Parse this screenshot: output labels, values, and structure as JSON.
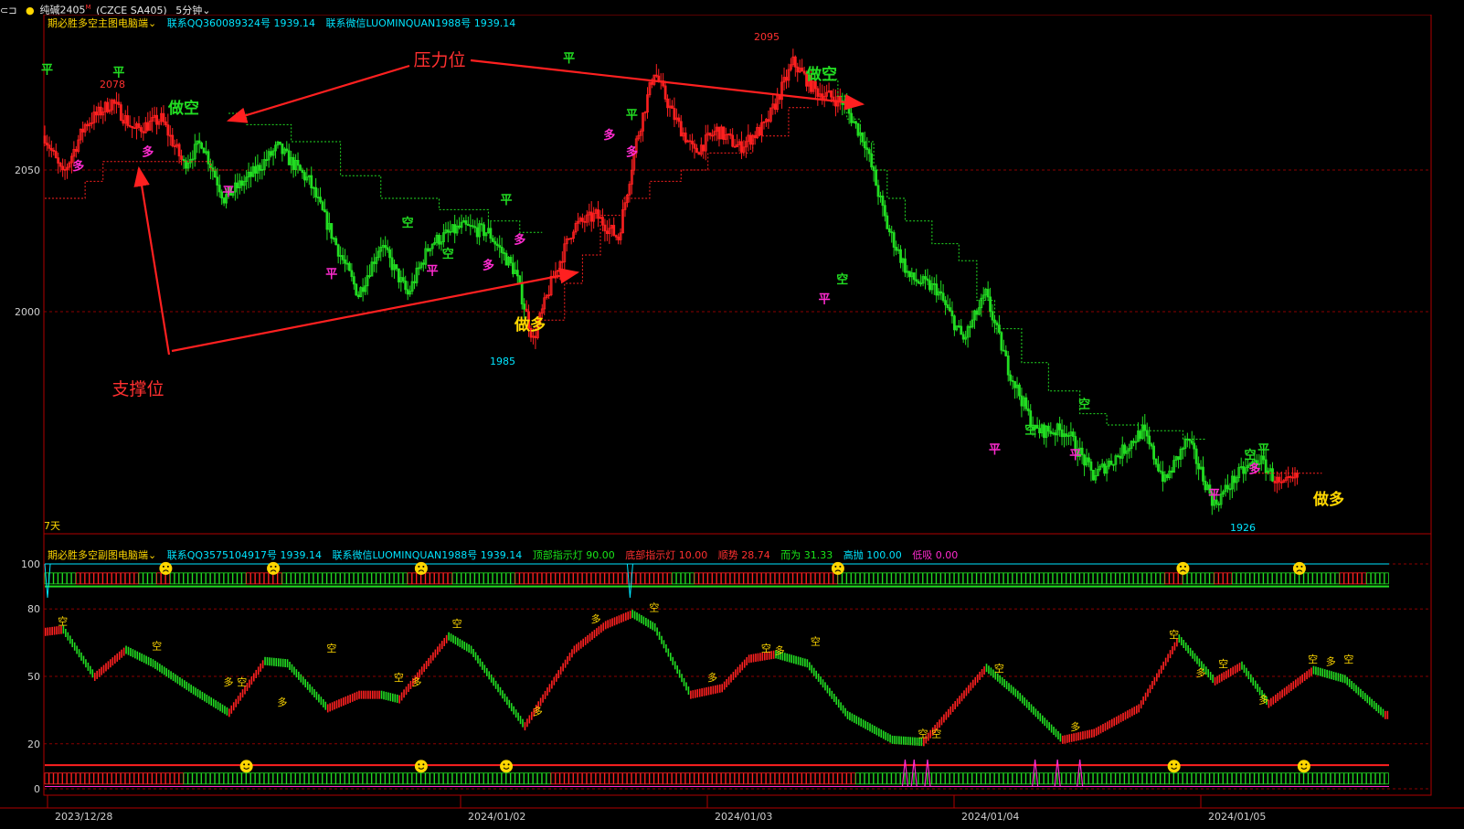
{
  "topbar": {
    "menu_icon": "window-menu-icon",
    "dot_color": "#ffd700",
    "symbol": "纯碱2405",
    "symbol_sup": "M",
    "code": "(CZCE SA405)",
    "period": "5分钟"
  },
  "main_panel": {
    "title": "期必胜多空主图电脑端",
    "contact_qq": "联系QQ360089324号 1939.14",
    "contact_wx": "联系微信LUOMINQUAN1988号 1939.14",
    "corner_label": "7天",
    "annotations": {
      "pressure": "压力位",
      "support": "支撑位",
      "do_short_1": "做空",
      "do_short_2": "做空",
      "do_long_1": "做多",
      "do_long_2": "做多"
    },
    "price_labels": {
      "high1": "2078",
      "high2": "2095",
      "low1": "1985",
      "low2": "1926"
    }
  },
  "sub_panel": {
    "title": "期必胜多空副图电脑端",
    "contact_qq": "联系QQ3575104917号 1939.14",
    "contact_wx": "联系微信LUOMINQUAN1988号 1939.14",
    "top_light": "顶部指示灯 90.00",
    "bottom_light": "底部指示灯 10.00",
    "trend": "顺势 28.74",
    "wei": "而为 31.33",
    "high_sell": "高抛 100.00",
    "low_buy": "低吸 0.00"
  },
  "x_axis": [
    "2023/12/28",
    "2024/01/02",
    "2024/01/03",
    "2024/01/04",
    "2024/01/05"
  ],
  "colors": {
    "up": "#ff2020",
    "down": "#22dd22",
    "grid": "#8b0000",
    "resist": "#22dd22",
    "support": "#ff2020",
    "arrow": "#ff2020",
    "axis_text": "#cfcfcf"
  },
  "chart_data": [
    {
      "type": "candlestick",
      "title": "期必胜多空主图电脑端",
      "y_ticks": [
        2050,
        2000
      ],
      "ylim": [
        1920,
        2110
      ],
      "path_points": [
        {
          "i": 0,
          "p": 2062
        },
        {
          "i": 8,
          "p": 2048
        },
        {
          "i": 18,
          "p": 2066
        },
        {
          "i": 30,
          "p": 2074
        },
        {
          "i": 40,
          "p": 2064
        },
        {
          "i": 52,
          "p": 2068
        },
        {
          "i": 62,
          "p": 2052
        },
        {
          "i": 70,
          "p": 2060
        },
        {
          "i": 80,
          "p": 2040
        },
        {
          "i": 92,
          "p": 2048
        },
        {
          "i": 104,
          "p": 2058
        },
        {
          "i": 118,
          "p": 2046
        },
        {
          "i": 132,
          "p": 2020
        },
        {
          "i": 140,
          "p": 2006
        },
        {
          "i": 150,
          "p": 2024
        },
        {
          "i": 162,
          "p": 2006
        },
        {
          "i": 172,
          "p": 2024
        },
        {
          "i": 186,
          "p": 2030
        },
        {
          "i": 198,
          "p": 2028
        },
        {
          "i": 210,
          "p": 2014
        },
        {
          "i": 218,
          "p": 1990
        },
        {
          "i": 226,
          "p": 2010
        },
        {
          "i": 236,
          "p": 2030
        },
        {
          "i": 246,
          "p": 2034
        },
        {
          "i": 256,
          "p": 2026
        },
        {
          "i": 264,
          "p": 2060
        },
        {
          "i": 272,
          "p": 2085
        },
        {
          "i": 280,
          "p": 2070
        },
        {
          "i": 290,
          "p": 2056
        },
        {
          "i": 300,
          "p": 2064
        },
        {
          "i": 310,
          "p": 2058
        },
        {
          "i": 322,
          "p": 2066
        },
        {
          "i": 334,
          "p": 2088
        },
        {
          "i": 344,
          "p": 2078
        },
        {
          "i": 356,
          "p": 2074
        },
        {
          "i": 366,
          "p": 2060
        },
        {
          "i": 376,
          "p": 2030
        },
        {
          "i": 386,
          "p": 2012
        },
        {
          "i": 398,
          "p": 2008
        },
        {
          "i": 410,
          "p": 1990
        },
        {
          "i": 420,
          "p": 2006
        },
        {
          "i": 430,
          "p": 1980
        },
        {
          "i": 442,
          "p": 1958
        },
        {
          "i": 456,
          "p": 1958
        },
        {
          "i": 468,
          "p": 1942
        },
        {
          "i": 480,
          "p": 1950
        },
        {
          "i": 490,
          "p": 1958
        },
        {
          "i": 500,
          "p": 1940
        },
        {
          "i": 510,
          "p": 1955
        },
        {
          "i": 522,
          "p": 1932
        },
        {
          "i": 532,
          "p": 1942
        },
        {
          "i": 542,
          "p": 1948
        },
        {
          "i": 552,
          "p": 1938
        },
        {
          "i": 560,
          "p": 1942
        }
      ],
      "resistance_steps": [
        {
          "i": 82,
          "p": 2070
        },
        {
          "i": 90,
          "p": 2066
        },
        {
          "i": 110,
          "p": 2060
        },
        {
          "i": 132,
          "p": 2048
        },
        {
          "i": 150,
          "p": 2040
        },
        {
          "i": 176,
          "p": 2036
        },
        {
          "i": 198,
          "p": 2032
        },
        {
          "i": 212,
          "p": 2028
        },
        {
          "i": 348,
          "p": 2082
        },
        {
          "i": 354,
          "p": 2076
        },
        {
          "i": 358,
          "p": 2068
        },
        {
          "i": 364,
          "p": 2060
        },
        {
          "i": 370,
          "p": 2050
        },
        {
          "i": 376,
          "p": 2040
        },
        {
          "i": 384,
          "p": 2032
        },
        {
          "i": 396,
          "p": 2024
        },
        {
          "i": 408,
          "p": 2018
        },
        {
          "i": 416,
          "p": 2004
        },
        {
          "i": 424,
          "p": 1994
        },
        {
          "i": 436,
          "p": 1982
        },
        {
          "i": 448,
          "p": 1972
        },
        {
          "i": 462,
          "p": 1964
        },
        {
          "i": 474,
          "p": 1960
        },
        {
          "i": 490,
          "p": 1958
        },
        {
          "i": 508,
          "p": 1955
        }
      ],
      "support_steps": [
        {
          "i": 0,
          "p": 2040
        },
        {
          "i": 18,
          "p": 2046
        },
        {
          "i": 26,
          "p": 2053
        },
        {
          "i": 74,
          "p": 2050
        },
        {
          "i": 218,
          "p": 1997
        },
        {
          "i": 232,
          "p": 2010
        },
        {
          "i": 240,
          "p": 2020
        },
        {
          "i": 248,
          "p": 2034
        },
        {
          "i": 258,
          "p": 2040
        },
        {
          "i": 270,
          "p": 2046
        },
        {
          "i": 284,
          "p": 2050
        },
        {
          "i": 296,
          "p": 2056
        },
        {
          "i": 316,
          "p": 2062
        },
        {
          "i": 332,
          "p": 2072
        },
        {
          "i": 540,
          "p": 1943
        },
        {
          "i": 560,
          "p": 1943
        }
      ],
      "signals": [
        {
          "i": 1,
          "p": 2084,
          "t": "平",
          "c": "#22dd22"
        },
        {
          "i": 33,
          "p": 2083,
          "t": "平",
          "c": "#22dd22"
        },
        {
          "i": 15,
          "p": 2050,
          "t": "多",
          "c": "#ff2bd0"
        },
        {
          "i": 46,
          "p": 2055,
          "t": "多",
          "c": "#ff2bd0"
        },
        {
          "i": 82,
          "p": 2041,
          "t": "平",
          "c": "#ff2bd0"
        },
        {
          "i": 128,
          "p": 2012,
          "t": "平",
          "c": "#ff2bd0"
        },
        {
          "i": 162,
          "p": 2030,
          "t": "空",
          "c": "#22dd22"
        },
        {
          "i": 180,
          "p": 2019,
          "t": "空",
          "c": "#22dd22"
        },
        {
          "i": 173,
          "p": 2013,
          "t": "平",
          "c": "#ff2bd0"
        },
        {
          "i": 198,
          "p": 2015,
          "t": "多",
          "c": "#ff2bd0"
        },
        {
          "i": 206,
          "p": 2038,
          "t": "平",
          "c": "#22dd22"
        },
        {
          "i": 212,
          "p": 2024,
          "t": "多",
          "c": "#ff2bd0"
        },
        {
          "i": 234,
          "p": 2088,
          "t": "平",
          "c": "#22dd22"
        },
        {
          "i": 252,
          "p": 2061,
          "t": "多",
          "c": "#ff2bd0"
        },
        {
          "i": 262,
          "p": 2068,
          "t": "平",
          "c": "#22dd22"
        },
        {
          "i": 262,
          "p": 2055,
          "t": "多",
          "c": "#ff2bd0"
        },
        {
          "i": 356,
          "p": 2010,
          "t": "空",
          "c": "#22dd22"
        },
        {
          "i": 348,
          "p": 2003,
          "t": "平",
          "c": "#ff2bd0"
        },
        {
          "i": 424,
          "p": 1950,
          "t": "平",
          "c": "#ff2bd0"
        },
        {
          "i": 440,
          "p": 1957,
          "t": "空",
          "c": "#22dd22"
        },
        {
          "i": 460,
          "p": 1948,
          "t": "平",
          "c": "#ff2bd0"
        },
        {
          "i": 464,
          "p": 1966,
          "t": "空",
          "c": "#22dd22"
        },
        {
          "i": 522,
          "p": 1934,
          "t": "平",
          "c": "#ff2bd0"
        },
        {
          "i": 538,
          "p": 1948,
          "t": "空",
          "c": "#22dd22"
        },
        {
          "i": 544,
          "p": 1950,
          "t": "平",
          "c": "#22dd22"
        },
        {
          "i": 540,
          "p": 1943,
          "t": "多",
          "c": "#ff2bd0"
        }
      ]
    },
    {
      "type": "bar",
      "title": "期必胜多空副图电脑端",
      "y_ticks": [
        100,
        80,
        50,
        20,
        0
      ],
      "ylim": [
        0,
        100
      ],
      "curve_points": [
        {
          "i": 0,
          "v": 70
        },
        {
          "i": 8,
          "v": 71
        },
        {
          "i": 22,
          "v": 50
        },
        {
          "i": 36,
          "v": 62
        },
        {
          "i": 48,
          "v": 56
        },
        {
          "i": 66,
          "v": 44
        },
        {
          "i": 82,
          "v": 34
        },
        {
          "i": 98,
          "v": 57
        },
        {
          "i": 108,
          "v": 56
        },
        {
          "i": 126,
          "v": 36
        },
        {
          "i": 140,
          "v": 42
        },
        {
          "i": 150,
          "v": 42
        },
        {
          "i": 158,
          "v": 40
        },
        {
          "i": 180,
          "v": 68
        },
        {
          "i": 190,
          "v": 62
        },
        {
          "i": 214,
          "v": 28
        },
        {
          "i": 236,
          "v": 62
        },
        {
          "i": 250,
          "v": 73
        },
        {
          "i": 262,
          "v": 78
        },
        {
          "i": 272,
          "v": 72
        },
        {
          "i": 288,
          "v": 42
        },
        {
          "i": 302,
          "v": 45
        },
        {
          "i": 314,
          "v": 58
        },
        {
          "i": 326,
          "v": 60
        },
        {
          "i": 340,
          "v": 56
        },
        {
          "i": 358,
          "v": 33
        },
        {
          "i": 378,
          "v": 22
        },
        {
          "i": 392,
          "v": 21
        },
        {
          "i": 404,
          "v": 35
        },
        {
          "i": 420,
          "v": 54
        },
        {
          "i": 434,
          "v": 42
        },
        {
          "i": 454,
          "v": 22
        },
        {
          "i": 468,
          "v": 25
        },
        {
          "i": 488,
          "v": 36
        },
        {
          "i": 506,
          "v": 67
        },
        {
          "i": 522,
          "v": 48
        },
        {
          "i": 534,
          "v": 55
        },
        {
          "i": 546,
          "v": 38
        },
        {
          "i": 566,
          "v": 53
        },
        {
          "i": 580,
          "v": 49
        },
        {
          "i": 598,
          "v": 33
        }
      ],
      "signals": [
        {
          "i": 8,
          "v": 73,
          "t": "空",
          "c": "#ffd700"
        },
        {
          "i": 50,
          "v": 62,
          "t": "空",
          "c": "#ffd700"
        },
        {
          "i": 88,
          "v": 46,
          "t": "空",
          "c": "#ffd700"
        },
        {
          "i": 82,
          "v": 46,
          "t": "多",
          "c": "#ffd700"
        },
        {
          "i": 106,
          "v": 37,
          "t": "多",
          "c": "#ffd700"
        },
        {
          "i": 128,
          "v": 61,
          "t": "空",
          "c": "#ffd700"
        },
        {
          "i": 158,
          "v": 48,
          "t": "空",
          "c": "#ffd700"
        },
        {
          "i": 166,
          "v": 46,
          "t": "多",
          "c": "#ffd700"
        },
        {
          "i": 184,
          "v": 72,
          "t": "空",
          "c": "#ffd700"
        },
        {
          "i": 220,
          "v": 33,
          "t": "多",
          "c": "#ffd700"
        },
        {
          "i": 246,
          "v": 74,
          "t": "多",
          "c": "#ffd700"
        },
        {
          "i": 272,
          "v": 79,
          "t": "空",
          "c": "#ffd700"
        },
        {
          "i": 298,
          "v": 48,
          "t": "多",
          "c": "#ffd700"
        },
        {
          "i": 322,
          "v": 61,
          "t": "空",
          "c": "#ffd700"
        },
        {
          "i": 328,
          "v": 60,
          "t": "多",
          "c": "#ffd700"
        },
        {
          "i": 344,
          "v": 64,
          "t": "空",
          "c": "#ffd700"
        },
        {
          "i": 392,
          "v": 23,
          "t": "空",
          "c": "#ffd700"
        },
        {
          "i": 398,
          "v": 23,
          "t": "空",
          "c": "#ffd700"
        },
        {
          "i": 426,
          "v": 52,
          "t": "空",
          "c": "#ffd700"
        },
        {
          "i": 460,
          "v": 26,
          "t": "多",
          "c": "#ffd700"
        },
        {
          "i": 504,
          "v": 67,
          "t": "空",
          "c": "#ffd700"
        },
        {
          "i": 516,
          "v": 50,
          "t": "多",
          "c": "#ffd700"
        },
        {
          "i": 526,
          "v": 54,
          "t": "空",
          "c": "#ffd700"
        },
        {
          "i": 544,
          "v": 38,
          "t": "多",
          "c": "#ffd700"
        },
        {
          "i": 566,
          "v": 56,
          "t": "空",
          "c": "#ffd700"
        },
        {
          "i": 574,
          "v": 55,
          "t": "多",
          "c": "#ffd700"
        },
        {
          "i": 582,
          "v": 56,
          "t": "空",
          "c": "#ffd700"
        }
      ],
      "top_band_segments": [
        {
          "from": 0,
          "to": 14,
          "c": "#22dd22"
        },
        {
          "from": 14,
          "to": 42,
          "c": "#ff2020"
        },
        {
          "from": 42,
          "to": 50,
          "c": "#22dd22"
        },
        {
          "from": 50,
          "to": 56,
          "c": "#ff2020"
        },
        {
          "from": 56,
          "to": 90,
          "c": "#22dd22"
        },
        {
          "from": 90,
          "to": 106,
          "c": "#ff2020"
        },
        {
          "from": 106,
          "to": 162,
          "c": "#22dd22"
        },
        {
          "from": 162,
          "to": 182,
          "c": "#ff2020"
        },
        {
          "from": 182,
          "to": 210,
          "c": "#22dd22"
        },
        {
          "from": 210,
          "to": 280,
          "c": "#ff2020"
        },
        {
          "from": 280,
          "to": 290,
          "c": "#22dd22"
        },
        {
          "from": 290,
          "to": 354,
          "c": "#ff2020"
        },
        {
          "from": 354,
          "to": 500,
          "c": "#22dd22"
        },
        {
          "from": 500,
          "to": 508,
          "c": "#ff2020"
        },
        {
          "from": 508,
          "to": 522,
          "c": "#22dd22"
        },
        {
          "from": 522,
          "to": 530,
          "c": "#ff2020"
        },
        {
          "from": 530,
          "to": 578,
          "c": "#22dd22"
        },
        {
          "from": 578,
          "to": 590,
          "c": "#ff2020"
        },
        {
          "from": 590,
          "to": 600,
          "c": "#22dd22"
        }
      ],
      "top_faces": [
        {
          "i": 54,
          "m": "frown"
        },
        {
          "i": 102,
          "m": "frown"
        },
        {
          "i": 168,
          "m": "frown"
        },
        {
          "i": 354,
          "m": "frown"
        },
        {
          "i": 508,
          "m": "frown"
        },
        {
          "i": 560,
          "m": "frown"
        }
      ],
      "bottom_band_segments": [
        {
          "from": 0,
          "to": 62,
          "c": "#ff2020"
        },
        {
          "from": 62,
          "to": 226,
          "c": "#22dd22"
        },
        {
          "from": 226,
          "to": 362,
          "c": "#ff2020"
        },
        {
          "from": 362,
          "to": 600,
          "c": "#22dd22"
        }
      ],
      "bottom_faces": [
        {
          "i": 90,
          "m": "smile"
        },
        {
          "i": 168,
          "m": "smile"
        },
        {
          "i": 206,
          "m": "smile"
        },
        {
          "i": 504,
          "m": "smile"
        },
        {
          "i": 562,
          "m": "smile"
        }
      ],
      "bottom_spikes": [
        384,
        388,
        394,
        442,
        452,
        462
      ],
      "top_dips": [
        0,
        260
      ]
    }
  ]
}
